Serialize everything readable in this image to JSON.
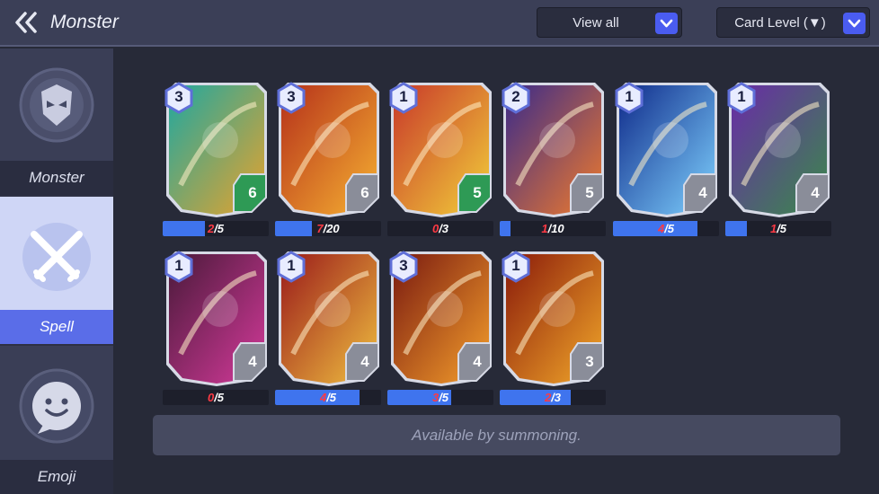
{
  "header": {
    "title": "Monster",
    "view_filter": "View all",
    "sort_filter": "Card Level (▼)"
  },
  "sidebar": {
    "tabs": [
      {
        "label": "Monster",
        "icon": "monster-helmet-icon",
        "selected": false
      },
      {
        "label": "Spell",
        "icon": "crossed-swords-icon",
        "selected": true
      },
      {
        "label": "Emoji",
        "icon": "smiley-emoji-icon",
        "selected": false
      }
    ]
  },
  "cards": [
    {
      "level": "3",
      "cost": "6",
      "cost_color": "#2e9a55",
      "progress_current": "2",
      "progress_total": "/5",
      "progress_fraction": 0.4,
      "art_name": "healing-figure-art",
      "colors": [
        "#1fa8a0",
        "#e8a22c"
      ]
    },
    {
      "level": "3",
      "cost": "6",
      "cost_color": "#8a8d99",
      "progress_current": "7",
      "progress_total": "/20",
      "progress_fraction": 0.35,
      "art_name": "fire-arrow-art",
      "colors": [
        "#b5301a",
        "#f6b132"
      ]
    },
    {
      "level": "1",
      "cost": "5",
      "cost_color": "#2e9a55",
      "progress_current": "0",
      "progress_total": "/3",
      "progress_fraction": 0.0,
      "art_name": "holy-sword-shield-art",
      "colors": [
        "#c8382a",
        "#f2d03a"
      ]
    },
    {
      "level": "2",
      "cost": "5",
      "cost_color": "#8a8d99",
      "progress_current": "1",
      "progress_total": "/10",
      "progress_fraction": 0.1,
      "art_name": "fire-beam-art",
      "colors": [
        "#3a2a8a",
        "#f07b2c"
      ]
    },
    {
      "level": "1",
      "cost": "4",
      "cost_color": "#8a8d99",
      "progress_current": "4",
      "progress_total": "/5",
      "progress_fraction": 0.8,
      "art_name": "lightning-art",
      "colors": [
        "#0f2a8a",
        "#7fd2ff"
      ]
    },
    {
      "level": "1",
      "cost": "4",
      "cost_color": "#8a8d99",
      "progress_current": "1",
      "progress_total": "/5",
      "progress_fraction": 0.2,
      "art_name": "shadow-claw-art",
      "colors": [
        "#6a2aa8",
        "#3a8a4a"
      ]
    },
    {
      "level": "1",
      "cost": "4",
      "cost_color": "#8a8d99",
      "progress_current": "0",
      "progress_total": "/5",
      "progress_fraction": 0.0,
      "art_name": "chains-art",
      "colors": [
        "#4a1a3a",
        "#d43a9a"
      ]
    },
    {
      "level": "1",
      "cost": "4",
      "cost_color": "#8a8d99",
      "progress_current": "4",
      "progress_total": "/5",
      "progress_fraction": 0.8,
      "art_name": "glowing-figure-art",
      "colors": [
        "#9a1a1a",
        "#f0c040"
      ]
    },
    {
      "level": "3",
      "cost": "4",
      "cost_color": "#8a8d99",
      "progress_current": "3",
      "progress_total": "/5",
      "progress_fraction": 0.6,
      "art_name": "meteor-art",
      "colors": [
        "#7a1a10",
        "#f6a02c"
      ]
    },
    {
      "level": "1",
      "cost": "3",
      "cost_color": "#8a8d99",
      "progress_current": "2",
      "progress_total": "/3",
      "progress_fraction": 0.67,
      "art_name": "fire-demon-art",
      "colors": [
        "#8a1a0a",
        "#f2a82a"
      ]
    }
  ],
  "notice": "Available by summoning."
}
